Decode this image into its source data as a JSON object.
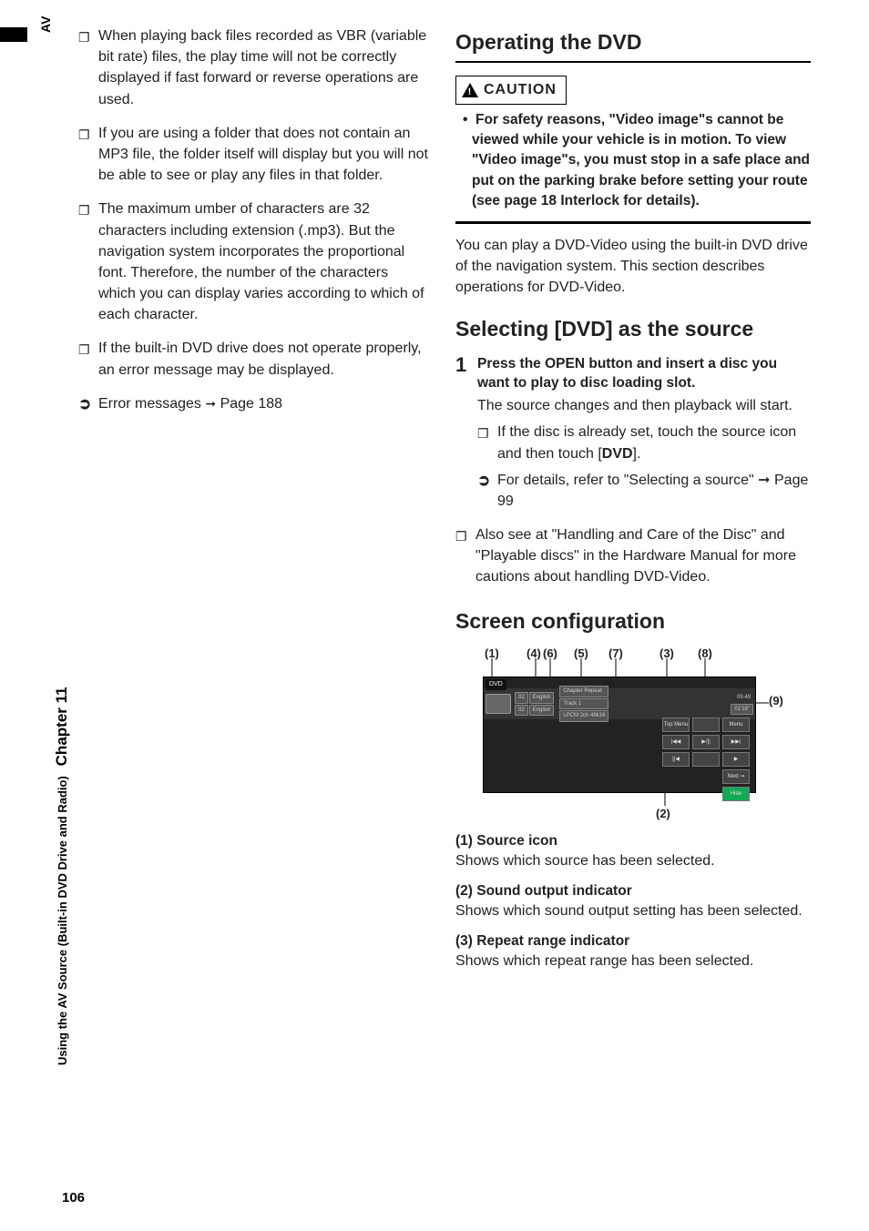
{
  "side": {
    "av": "AV",
    "text": "Using the AV Source (Built-in DVD Drive and Radio)",
    "chapter": "Chapter 11",
    "page": "106"
  },
  "left": {
    "bullets": [
      "When playing back files recorded as VBR (variable bit rate) files, the play time will not be correctly displayed if fast forward or reverse operations are used.",
      "If you are using a folder that does not contain an MP3 file, the folder itself will display but you will not be able to see or play any files in that folder.",
      "The maximum umber of characters are 32 characters including extension (.mp3). But the navigation system incorporates the proportional font. Therefore, the number of the characters which you can display varies according to which of each character.",
      "If the built-in DVD drive does not operate properly, an error message may be displayed."
    ],
    "ref_prefix": "Error messages",
    "ref_arrow": "➞",
    "ref_page": "Page 188"
  },
  "right": {
    "h1_prefix": "Operating the ",
    "h1_bold": "DVD",
    "caution_label": "CAUTION",
    "caution_text": "For safety reasons, \"Video image\"s cannot be viewed while your vehicle is in motion. To view \"Video image\"s, you must stop in a safe place and put on the parking brake before setting your route (see page 18 Interlock for details).",
    "intro": "You can play a DVD-Video using the built-in DVD drive of the navigation system. This section describes operations for DVD-Video.",
    "h2a_prefix": "Selecting [",
    "h2a_bold": "DVD",
    "h2a_suffix": "] as the source",
    "step1": {
      "num": "1",
      "lead_prefix": "Press the ",
      "lead_bold": "OPEN",
      "lead_suffix": " button and insert a disc you want to play to disc loading slot.",
      "sub": "The source changes and then playback will start.",
      "sb_prefix": "If the disc is already set, touch the source icon and then touch [",
      "sb_bold": "DVD",
      "sb_suffix": "].",
      "sup": "For details, refer to \"Selecting a source\" ➞ Page 99"
    },
    "note": "Also see at \"Handling and Care of the Disc\" and \"Playable discs\" in the Hardware Manual for more cautions about handling DVD-Video.",
    "h2b": "Screen configuration",
    "fig": {
      "top_labels": [
        "(1)",
        "(4)",
        "(6)",
        "(5)",
        "(7)",
        "(3)",
        "(8)"
      ],
      "right_label": "(9)",
      "bottom_label": "(2)",
      "dvd": "DVD",
      "chips": [
        "02",
        "02",
        "English",
        "English",
        "Chapter Repeat",
        "Track 1",
        "LPCM 2ch 48k16",
        "05:49",
        "01'18\""
      ],
      "controls": [
        "Top Menu",
        "",
        "Menu",
        "|◀◀",
        "▶/||",
        "▶▶|",
        "||◀",
        "",
        "▶",
        "",
        "",
        "Next ➞",
        "",
        "",
        "Hide"
      ]
    },
    "desc": [
      {
        "t": "(1) Source icon",
        "b": "Shows which source has been selected."
      },
      {
        "t": "(2) Sound output indicator",
        "b": "Shows which sound output setting has been selected."
      },
      {
        "t": "(3) Repeat range indicator",
        "b": "Shows which repeat range has been selected."
      }
    ]
  }
}
